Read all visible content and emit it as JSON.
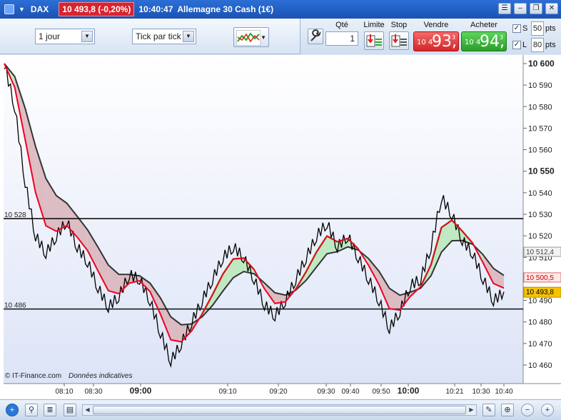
{
  "titlebar": {
    "instrument": "DAX",
    "price_change": "10 493,8 (-0,20%)",
    "time": "10:40:47",
    "name": "Allemagne 30 Cash (1€)"
  },
  "toolbar": {
    "period": "1 jour",
    "mode": "Tick par tick",
    "qty_label": "Qté",
    "qty_value": "1",
    "limit_label": "Limite",
    "stop_label": "Stop",
    "sell_label": "Vendre",
    "buy_label": "Acheter",
    "sell_price_small": "10 4",
    "sell_price_big": "93,",
    "sell_price_sup": "3",
    "buy_price_small": "10 4",
    "buy_price_big": "94,",
    "buy_price_sup": "3",
    "s_label": "S",
    "s_value": "50",
    "l_label": "L",
    "l_value": "80",
    "pts_label": "pts",
    "check_mark": "✓"
  },
  "chart": {
    "y_ticks": [
      "10 600",
      "10 590",
      "10 580",
      "10 570",
      "10 560",
      "10 550",
      "10 540",
      "10 530",
      "10 520",
      "10 510",
      "10 500",
      "10 490",
      "10 480",
      "10 470",
      "10 460"
    ],
    "bold_ticks": [
      "10 600",
      "10 550"
    ],
    "x_ticks": [
      "08:10",
      "08:30",
      "09:00",
      "09:10",
      "09:20",
      "09:30",
      "09:40",
      "09:50",
      "10:00",
      "10:21",
      "10:30",
      "10:40"
    ],
    "bold_x_ticks": [
      "09:00",
      "10:00"
    ],
    "h_line_high": "10 528",
    "h_line_low": "10 486",
    "label_512": "10 512,4",
    "label_500": "10 500,5",
    "label_last": "10 493,8",
    "copyright": "© IT-Finance.com",
    "indicative": "Données indicatives",
    "colors": {
      "bull": "#3fdc3f",
      "bear": "#e0202a",
      "cloud_up": "#b8e6b8",
      "cloud_down": "#d9b3b8",
      "last": "#f7c300"
    }
  },
  "chart_data": {
    "type": "line",
    "title": "",
    "ylim": [
      10455,
      10602
    ],
    "x_ticks": [
      "08:10",
      "08:30",
      "09:00",
      "09:10",
      "09:20",
      "09:30",
      "09:40",
      "09:50",
      "10:00",
      "10:21",
      "10:30",
      "10:40"
    ],
    "series": [
      {
        "values": [
          10600,
          10580,
          10545,
          10520,
          10512,
          10520,
          10527,
          10515,
          10508,
          10496,
          10487,
          10492,
          10502,
          10500,
          10490,
          10475,
          10462,
          10470,
          10480,
          10490,
          10500,
          10510,
          10515,
          10510,
          10500,
          10488,
          10483,
          10490,
          10500,
          10510,
          10520,
          10526,
          10515,
          10520,
          10510,
          10500,
          10490,
          10477,
          10485,
          10497,
          10500,
          10515,
          10538,
          10530,
          10518,
          10512,
          10500,
          10490,
          10494
        ]
      }
    ],
    "horizontal_lines": [
      10528,
      10486
    ],
    "last_value": 10493.8
  }
}
